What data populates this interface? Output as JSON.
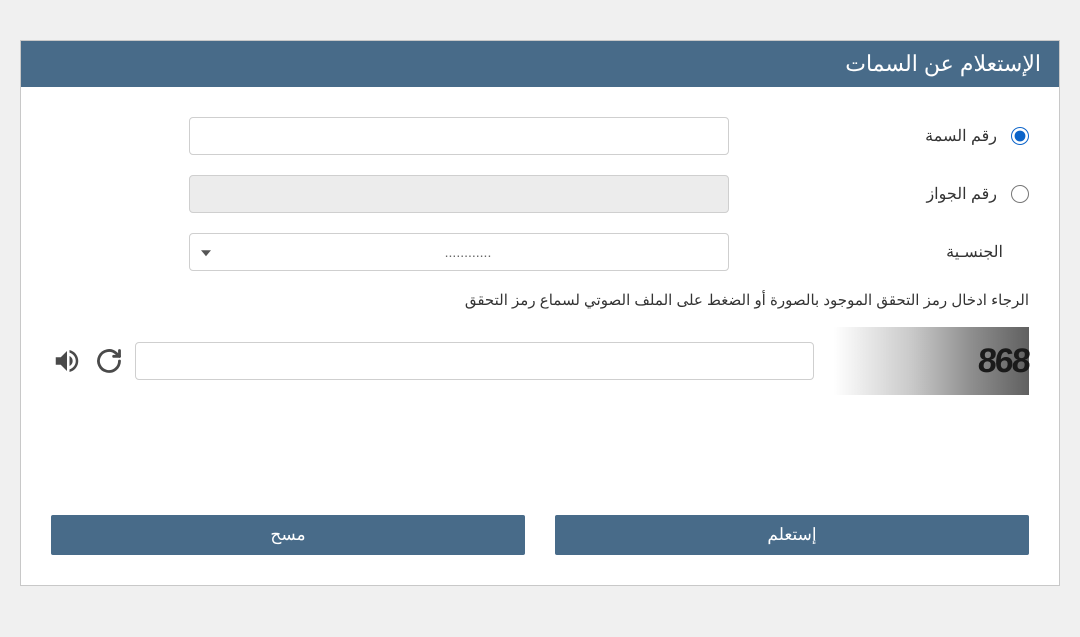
{
  "panel": {
    "title": "الإستعلام عن السمات"
  },
  "form": {
    "option_visa": {
      "label": "رقم السمة",
      "value": "",
      "disabled": false
    },
    "option_passport": {
      "label": "رقم الجواز",
      "value": "",
      "disabled": true
    },
    "nationality_label": "الجنسـية",
    "nationality_placeholder": "............",
    "nationality_selected": "............"
  },
  "captcha": {
    "instruction": "الرجاء ادخال رمز التحقق الموجود بالصورة أو الضغط على الملف الصوتي لسماع رمز التحقق",
    "image_text": "868",
    "input_value": ""
  },
  "buttons": {
    "submit": "إستعلم",
    "clear": "مسح"
  }
}
